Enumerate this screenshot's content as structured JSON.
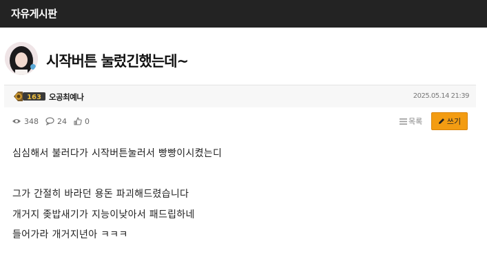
{
  "header": {
    "board_title": "자유게시판"
  },
  "post": {
    "title": "시작버튼 눌렀긴했는데~",
    "author": "오공최예나",
    "level": "163",
    "datetime": "2025.05.14 21:39",
    "views": "348",
    "comments": "24",
    "likes": "0",
    "body_lines": [
      "심심해서 불러다가 시작버튼눌러서 빵빵이시켰는디",
      "",
      "그가 간절히 바라던 용돈 파괴해드렸습니다",
      "개거지 좆밥새기가 지능이낮아서 패드립하네",
      "들어가라 개거지년아 ㅋㅋㅋ"
    ]
  },
  "actions": {
    "list_label": "목록",
    "write_label": "쓰기"
  },
  "icons": {
    "views": "eye-icon",
    "comments": "comment-icon",
    "likes": "thumbs-up-icon",
    "list": "list-icon",
    "write": "pencil-icon"
  },
  "colors": {
    "topbar": "#232323",
    "write_button": "#f39c12"
  }
}
